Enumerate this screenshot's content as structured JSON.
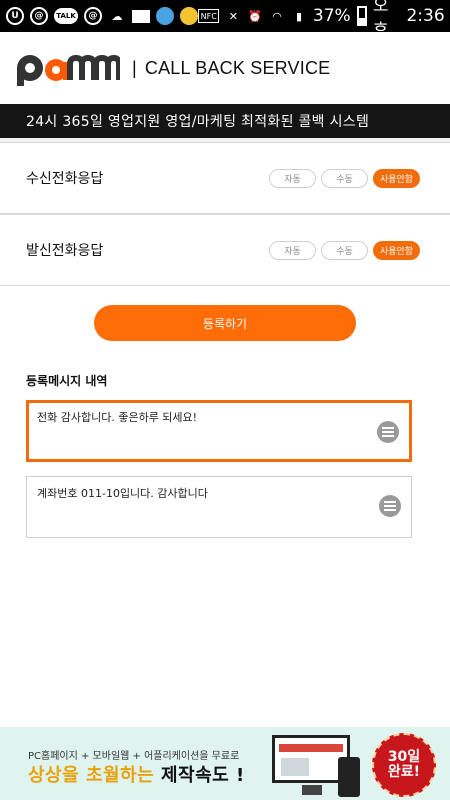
{
  "status_bar": {
    "battery": "37%",
    "period": "오후",
    "time": "2:36",
    "icons": [
      "kakao-icon",
      "at-icon",
      "talk-icon",
      "at-icon",
      "cloud-icon",
      "mail-icon",
      "emoji-icon",
      "emoji-icon",
      "nfc-icon",
      "mute-icon",
      "alarm-icon",
      "wifi-icon",
      "signal-icon",
      "battery-icon"
    ]
  },
  "header": {
    "logo_text": "PAMM",
    "title": "CALL BACK SERVICE",
    "banner": "24시 365일 영업지원 영업/마케팅 최적화된 콜백 시스템"
  },
  "settings": {
    "options": [
      "자동",
      "수동",
      "사용안함"
    ],
    "rows": [
      {
        "label": "수신전화응답",
        "selected": "사용안함"
      },
      {
        "label": "발신전화응답",
        "selected": "사용안함"
      }
    ]
  },
  "register_button": "등록하기",
  "messages": {
    "title": "등록메시지 내역",
    "items": [
      {
        "text": "전화 감사합니다. 좋은하루 되세요!",
        "active": true
      },
      {
        "text": "계좌번호 011-10입니다. 감사합니다",
        "active": false
      }
    ]
  },
  "ad": {
    "subtitle": "PC홈페이지 + 모바일웹 + 어플리케이션을 무료로",
    "headline_highlight": "상상을 초월하는",
    "headline_rest": "제작속도 !",
    "badge_line1": "30일",
    "badge_line2": "완료!"
  },
  "colors": {
    "accent": "#f26c0c",
    "banner_bg": "#151515",
    "ad_bg": "#dff3ef"
  }
}
